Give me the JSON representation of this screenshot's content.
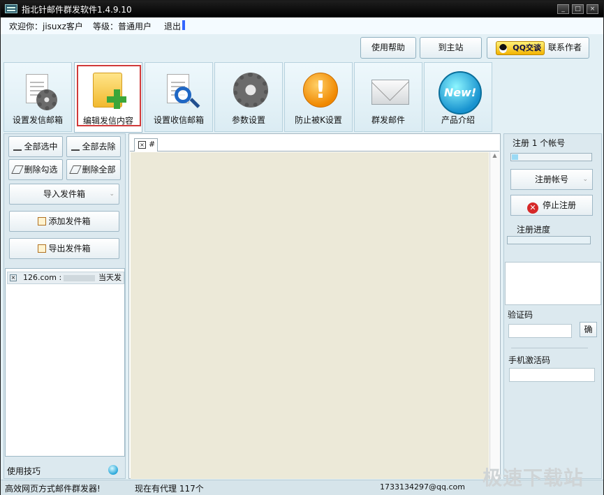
{
  "title_bar": {
    "title": "指北针邮件群发软件1.4.9.10",
    "buttons": [
      "_",
      "□",
      "×"
    ]
  },
  "user_bar": {
    "welcome": "欢迎你：jisuxz客户",
    "level": "等级：普通用户",
    "logout": "退出"
  },
  "top_buttons": {
    "help": "使用帮助",
    "home": "到主站",
    "qq_badge": "QQ交谈",
    "contact": "联系作者"
  },
  "toolbar": {
    "items": [
      {
        "label": "设置发信邮箱",
        "icon": "document-gear-icon"
      },
      {
        "label": "编辑发信内容",
        "icon": "folder-plus-icon",
        "selected": true
      },
      {
        "label": "设置收信邮箱",
        "icon": "document-search-icon"
      },
      {
        "label": "参数设置",
        "icon": "gear-icon"
      },
      {
        "label": "防止被K设置",
        "icon": "warning-icon"
      },
      {
        "label": "群发邮件",
        "icon": "envelope-icon"
      },
      {
        "label": "产品介绍",
        "icon": "new-badge-icon"
      }
    ],
    "new_badge_text": "New!",
    "warning_glyph": "!"
  },
  "left_panel": {
    "select_all": "全部选中",
    "deselect_all": "全部去除",
    "delete_checked": "删除勾选",
    "delete_all": "删除全部",
    "import_outbox": "导入发件箱",
    "add_outbox": "添加发件箱",
    "export_outbox": "导出发件箱",
    "accounts": [
      {
        "prefix": "126.com :",
        "status": "当天发"
      }
    ],
    "tips": "使用技巧"
  },
  "center": {
    "tab_name": "#",
    "tab_close": "×",
    "scroll_up": "▲"
  },
  "right_panel": {
    "register_count": "注册 1 个帐号",
    "register_progress_fraction": 0.08,
    "register_account": "注册帐号",
    "stop_register": "停止注册",
    "stop_icon_glyph": "✕",
    "register_progress_label": "注册进度",
    "captcha_label": "验证码",
    "confirm": "确",
    "phone_code_label": "手机激活码"
  },
  "status_bar": {
    "slogan": "高效网页方式邮件群发器!",
    "proxy": "现在有代理 117个",
    "email": "1733134297@qq.com"
  },
  "watermark": "极速下载站",
  "colors": {
    "selection_border": "#d03a3a",
    "accent_blue": "#3366ff"
  }
}
